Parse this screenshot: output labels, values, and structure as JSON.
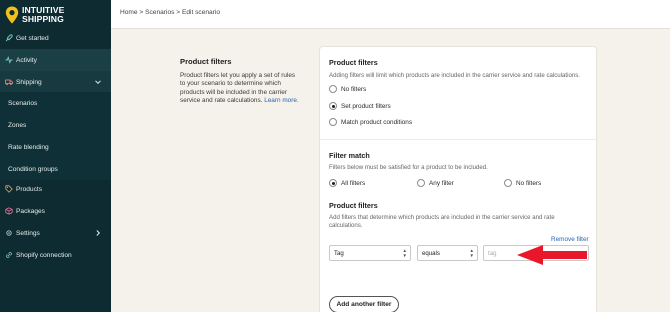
{
  "brand": {
    "line1": "INTUITIVE",
    "line2": "SHIPPING"
  },
  "sidebar": {
    "items": [
      {
        "label": "Get started",
        "icon": "rocket-icon"
      },
      {
        "label": "Activity",
        "icon": "activity-icon"
      },
      {
        "label": "Shipping",
        "icon": "truck-icon"
      },
      {
        "label": "Scenarios"
      },
      {
        "label": "Zones"
      },
      {
        "label": "Rate blending"
      },
      {
        "label": "Condition groups"
      },
      {
        "label": "Products",
        "icon": "tag-icon"
      },
      {
        "label": "Packages",
        "icon": "package-icon"
      },
      {
        "label": "Settings",
        "icon": "gear-icon"
      },
      {
        "label": "Shopify connection",
        "icon": "link-icon"
      }
    ]
  },
  "breadcrumb": {
    "text": "Home > Scenarios > Edit scenario"
  },
  "section": {
    "title": "Product filters",
    "description": "Product filters let you apply a set of rules to your scenario to determine which products will be included in the carrier service and rate calculations.",
    "learn_more": "Learn more."
  },
  "card": {
    "product_filters": {
      "title": "Product filters",
      "help": "Adding filters will limit which products are included in the carrier service and rate calculations.",
      "options": [
        "No filters",
        "Set product filters",
        "Match product conditions"
      ],
      "selected": "Set product filters"
    },
    "filter_match": {
      "title": "Filter match",
      "help": "Filters below must be satisfied for a product to be included.",
      "options": [
        "All filters",
        "Any filter",
        "No filters"
      ],
      "selected": "All filters"
    },
    "filters": {
      "title": "Product filters",
      "help": "Add filters that determine which products are included in the carrier service and rate calculations.",
      "remove_label": "Remove filter",
      "field_value": "Tag",
      "operator_value": "equals",
      "value_placeholder": "tag",
      "add_label": "Add another filter"
    }
  },
  "colors": {
    "sidebar": "#0d2b31",
    "accent_link": "#2566b0",
    "annotation_arrow": "#e8182a"
  }
}
